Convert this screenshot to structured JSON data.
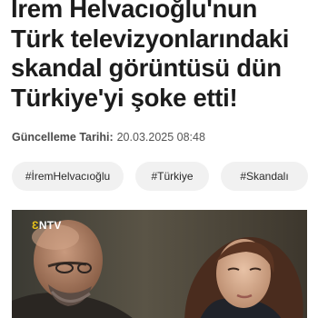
{
  "article": {
    "headline": "İrem Helvacıoğlu'nun Türk televizyonlarındaki skandal görüntüsü dün Türkiye'yi şoke etti!",
    "updated_label": "Güncelleme Tarihi:",
    "updated_value": "20.03.2025 08:48"
  },
  "tags": [
    {
      "label": "#İremHelvacıoğlu"
    },
    {
      "label": "#Türkiye"
    },
    {
      "label": "#Skandalı"
    }
  ],
  "video": {
    "channel_logo_mark": "Ɛ",
    "channel_logo_text": "NTV",
    "colors": {
      "background": "#4a463c",
      "logo_accent": "#e8c21a"
    }
  }
}
